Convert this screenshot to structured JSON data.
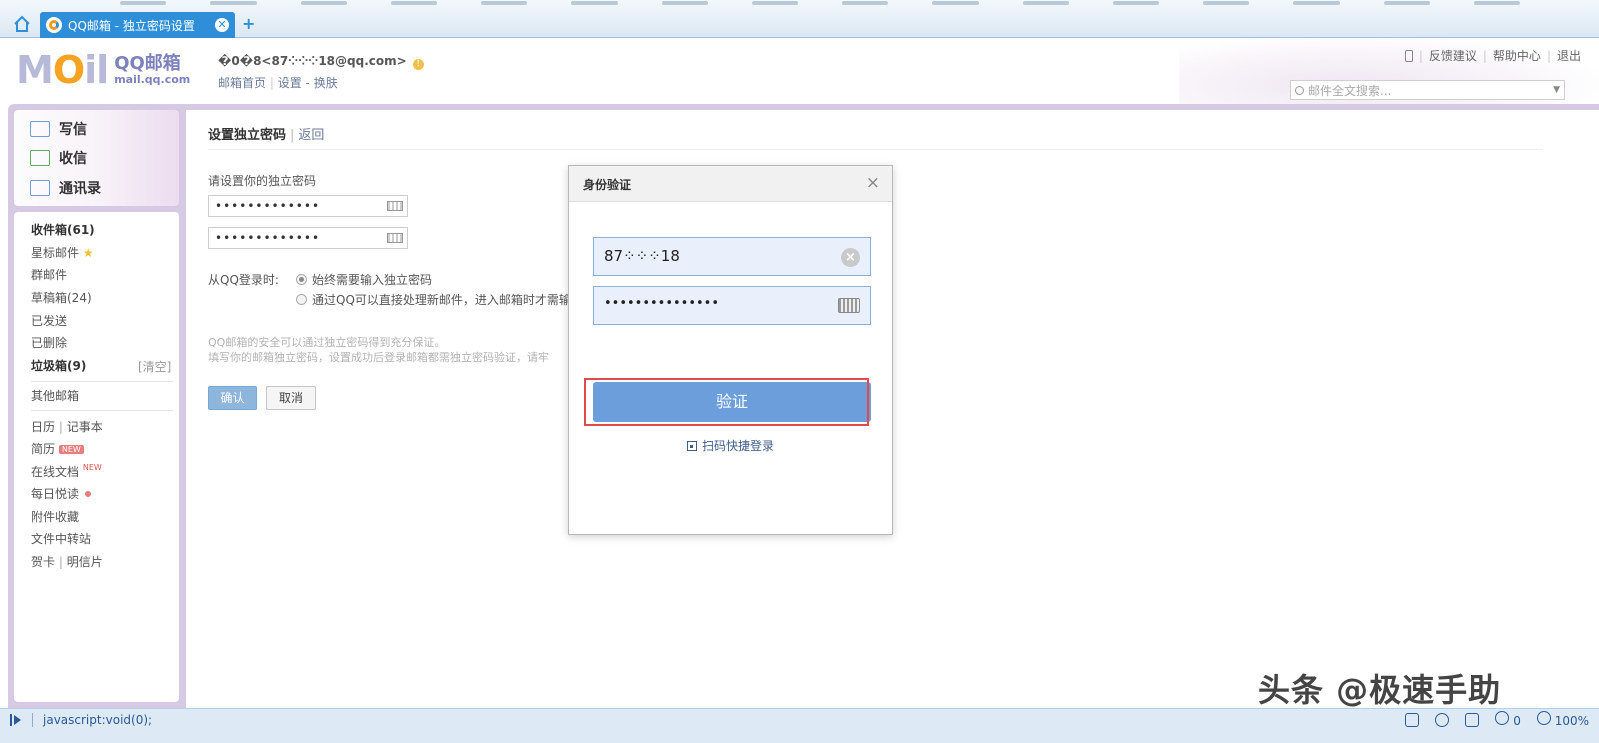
{
  "browser": {
    "tab_title": "QQ邮箱 - 独立密码设置",
    "tab_close": "✕",
    "new_tab": "+"
  },
  "header": {
    "logo_text_main": "M",
    "logo_text_o": "O",
    "logo_text_il": "il",
    "brand_cn": "QQ邮箱",
    "brand_domain": "mail.qq.com",
    "account_display": "�0�8<87⁘⁘⁘18@qq.com>",
    "warn_icon": "!",
    "link_home": "邮箱首页",
    "link_settings": "设置",
    "link_skin": "换肤",
    "top_feedback": "反馈建议",
    "top_help": "帮助中心",
    "top_logout": "退出",
    "search_placeholder": "邮件全文搜索..."
  },
  "sidebar": {
    "compose": "写信",
    "receive": "收信",
    "contacts": "通讯录",
    "inbox": "收件箱(61)",
    "starred": "星标邮件",
    "group": "群邮件",
    "drafts": "草稿箱(24)",
    "sent": "已发送",
    "deleted": "已删除",
    "junk": "垃圾箱(9)",
    "junk_clear": "[清空]",
    "other_mail": "其他邮箱",
    "calendar": "日历",
    "notes": "记事本",
    "resume": "简历",
    "resume_badge": "NEW",
    "docs": "在线文档",
    "docs_badge": "NEW",
    "daily": "每日悦读",
    "attachments": "附件收藏",
    "file_transfer": "文件中转站",
    "cards": "贺卡",
    "postcards": "明信片"
  },
  "main": {
    "title": "设置独立密码",
    "back": "返回",
    "prompt": "请设置你的独立密码",
    "password1": "•••••••••••••",
    "password2": "•••••••••••••",
    "login_label": "从QQ登录时:",
    "option1": "始终需要输入独立密码",
    "option2": "通过QQ可以直接处理新邮件，进入邮箱时才需输入",
    "note1": "QQ邮箱的安全可以通过独立密码得到充分保证。",
    "note2": "填写你的邮箱独立密码，设置成功后登录邮箱都需独立密码验证，请牢",
    "confirm_button": "确认",
    "cancel_button": "取消"
  },
  "modal": {
    "title": "身份验证",
    "close": "×",
    "account_value": "87⁘⁘⁘18",
    "password_value": "•••••••••••••••",
    "clear_icon": "×",
    "verify_button": "验证",
    "qr_login": "扫码快捷登录"
  },
  "watermark": "头条 @极速手助",
  "statusbar": {
    "url": "javascript:void(0);",
    "count": "0",
    "zoom": "100%"
  },
  "colors": {
    "accent": "#6b9edb",
    "highlight": "#e04a4a",
    "frame": "#d6c9e3"
  }
}
